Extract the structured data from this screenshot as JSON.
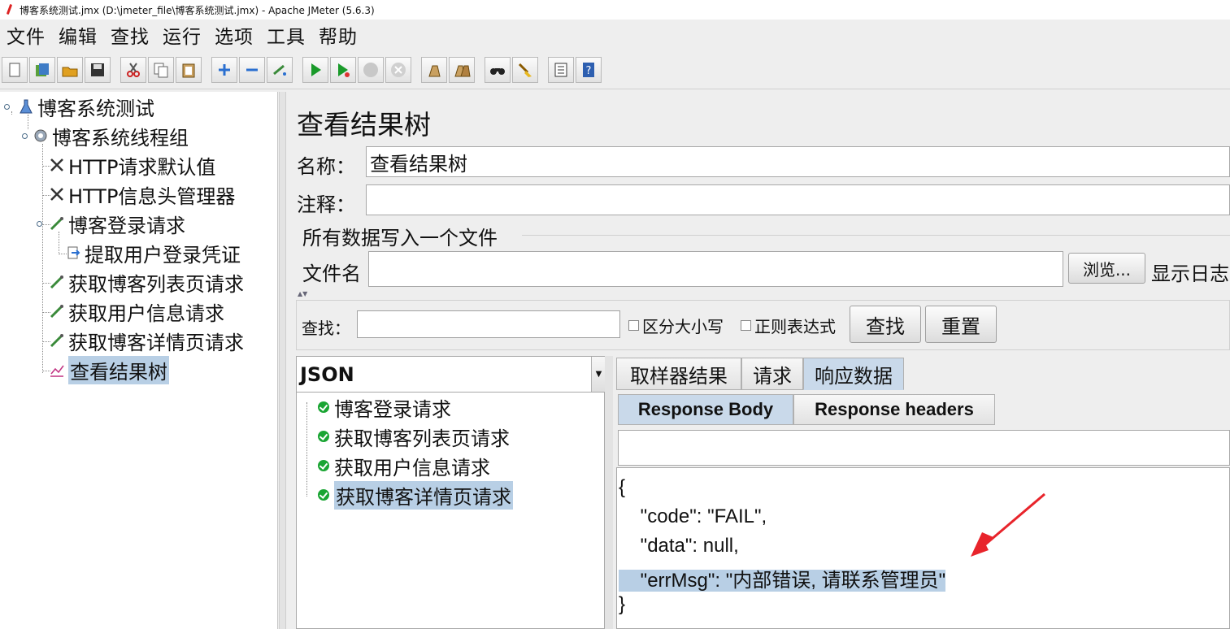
{
  "window": {
    "title": "博客系统测试.jmx (D:\\jmeter_file\\博客系统测试.jmx) - Apache JMeter (5.6.3)"
  },
  "menu": [
    "文件",
    "编辑",
    "查找",
    "运行",
    "选项",
    "工具",
    "帮助"
  ],
  "toolbar_icons": [
    "new-icon",
    "templates-icon",
    "open-icon",
    "save-icon",
    "cut-icon",
    "copy-icon",
    "paste-icon",
    "expand-icon",
    "collapse-icon",
    "toggle-icon",
    "start-icon",
    "start-no-pause-icon",
    "stop-icon",
    "shutdown-icon",
    "clear-icon",
    "clear-all-icon",
    "search-icon",
    "reset-search-icon",
    "function-helper-icon",
    "help-icon"
  ],
  "tree": {
    "root": "博客系统测试",
    "thread_group": "博客系统线程组",
    "items": [
      "HTTP请求默认值",
      "HTTP信息头管理器",
      "博客登录请求",
      "提取用户登录凭证",
      "获取博客列表页请求",
      "获取用户信息请求",
      "获取博客详情页请求",
      "查看结果树"
    ],
    "selected": "查看结果树"
  },
  "panel": {
    "title": "查看结果树",
    "name_label": "名称：",
    "name_value": "查看结果树",
    "comment_label": "注释：",
    "comment_value": "",
    "file_group_title": "所有数据写入一个文件",
    "filename_label": "文件名",
    "filename_value": "",
    "browse_label": "浏览...",
    "show_log_label": "显示日志"
  },
  "search": {
    "label": "查找：",
    "value": "",
    "case_label": "区分大小写",
    "regex_label": "正则表达式",
    "find_label": "查找",
    "reset_label": "重置"
  },
  "results": {
    "renderer": "JSON",
    "samples": [
      "博客登录请求",
      "获取博客列表页请求",
      "获取用户信息请求",
      "获取博客详情页请求"
    ],
    "selected": "获取博客详情页请求",
    "tabs": [
      "取样器结果",
      "请求",
      "响应数据"
    ],
    "active_tab": "响应数据",
    "subtabs": [
      "Response Body",
      "Response headers"
    ],
    "active_subtab": "Response Body",
    "body_lines": [
      "{",
      "    \"code\": \"FAIL\",",
      "    \"data\": null,",
      "    \"errMsg\": \"内部错误, 请联系管理员\"",
      "}"
    ]
  },
  "colors": {
    "selection": "#b8cfe5",
    "annotation_arrow": "#e8242b",
    "ok": "#1aa533"
  }
}
